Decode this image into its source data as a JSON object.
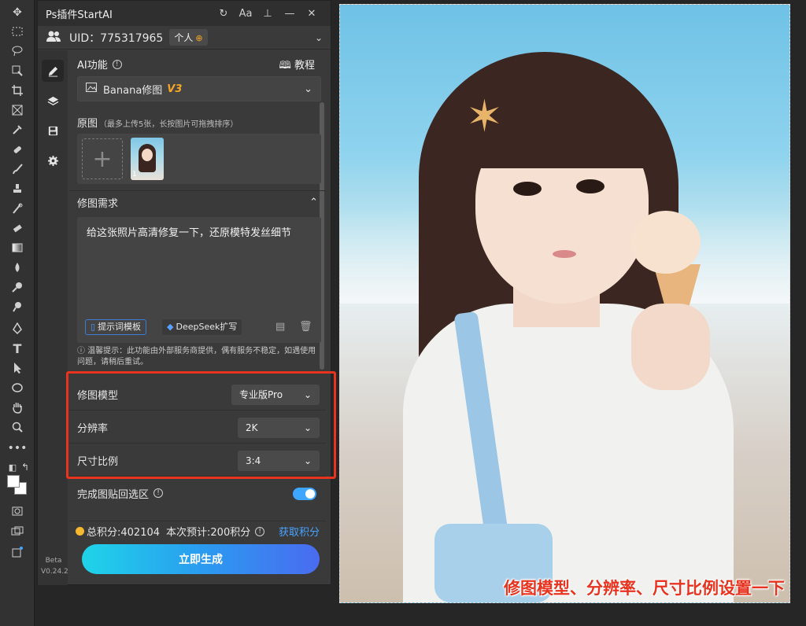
{
  "window": {
    "title": "Ps插件StartAI"
  },
  "account": {
    "uid_label": "UID：775317965",
    "plan": "个人",
    "plan_icon": "⊕"
  },
  "ai": {
    "section_label": "AI功能",
    "tutorial_label": "教程",
    "model_name": "Banana修图",
    "model_version": "V3"
  },
  "original": {
    "label": "原图",
    "hint": "（最多上传5张，长按图片可拖拽排序）",
    "thumb_count": "1"
  },
  "requirement": {
    "label": "修图需求",
    "text": "给这张照片高清修复一下，还原模特发丝细节",
    "template_btn": "提示词模板",
    "deepseek_btn": "DeepSeek扩写"
  },
  "notice": "温馨提示：此功能由外部服务商提供，偶有服务不稳定，如遇使用问题，请稍后重试。",
  "settings": {
    "model_label": "修图模型",
    "model_value": "专业版Pro",
    "resolution_label": "分辨率",
    "resolution_value": "2K",
    "ratio_label": "尺寸比例",
    "ratio_value": "3:4"
  },
  "paste_back": {
    "label": "完成图贴回选区",
    "enabled": true
  },
  "credits": {
    "total": "总积分:402104",
    "estimate": "本次预计:200积分",
    "get_label": "获取积分"
  },
  "generate_label": "立即生成",
  "version": {
    "channel": "Beta",
    "number": "V0.24.2"
  },
  "canvas": {
    "caption": "修图模型、分辨率、尺寸比例设置一下"
  },
  "colors": {
    "highlight": "#e8331f",
    "accent": "#3ea6ff",
    "version_badge": "#f5a623"
  }
}
